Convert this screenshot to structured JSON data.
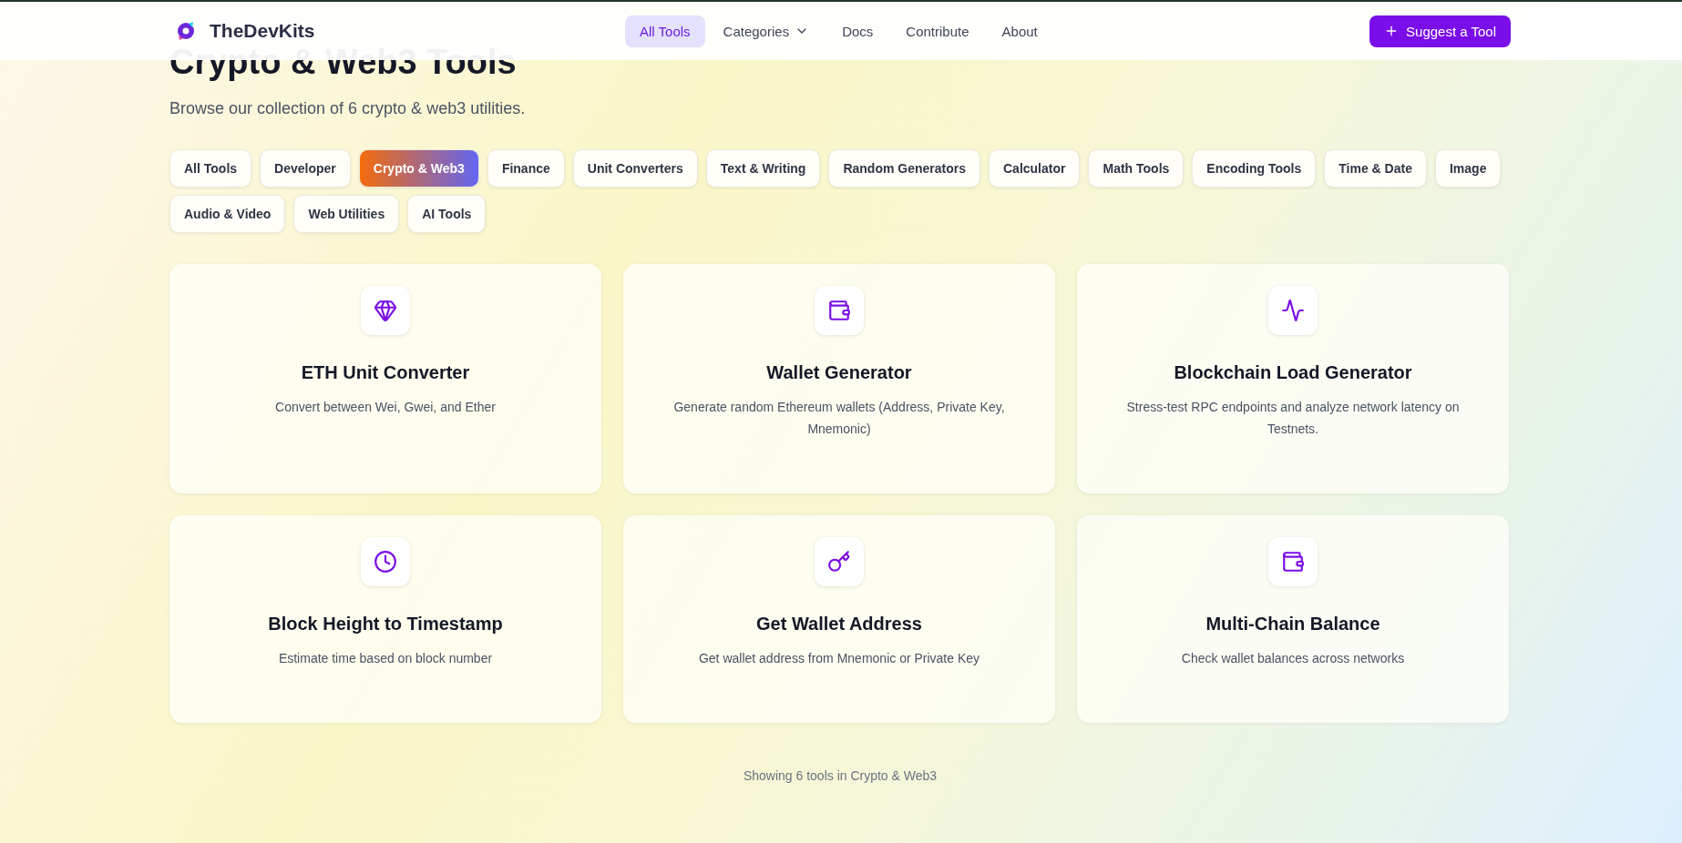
{
  "header": {
    "brand": "TheDevKits",
    "nav": [
      {
        "label": "All Tools",
        "selected": true,
        "dropdown": false
      },
      {
        "label": "Categories",
        "selected": false,
        "dropdown": true
      },
      {
        "label": "Docs",
        "selected": false,
        "dropdown": false
      },
      {
        "label": "Contribute",
        "selected": false,
        "dropdown": false
      },
      {
        "label": "About",
        "selected": false,
        "dropdown": false
      }
    ],
    "action": "Suggest a Tool"
  },
  "page": {
    "title": "Crypto & Web3 Tools",
    "subtitle": "Browse our collection of 6 crypto & web3 utilities."
  },
  "categories": [
    {
      "label": "All Tools",
      "selected": false
    },
    {
      "label": "Developer",
      "selected": false
    },
    {
      "label": "Crypto & Web3",
      "selected": true
    },
    {
      "label": "Finance",
      "selected": false
    },
    {
      "label": "Unit Converters",
      "selected": false
    },
    {
      "label": "Text & Writing",
      "selected": false
    },
    {
      "label": "Random Generators",
      "selected": false
    },
    {
      "label": "Calculator",
      "selected": false
    },
    {
      "label": "Math Tools",
      "selected": false
    },
    {
      "label": "Encoding Tools",
      "selected": false
    },
    {
      "label": "Time & Date",
      "selected": false
    },
    {
      "label": "Image",
      "selected": false
    },
    {
      "label": "Audio & Video",
      "selected": false
    },
    {
      "label": "Web Utilities",
      "selected": false
    },
    {
      "label": "AI Tools",
      "selected": false
    }
  ],
  "tools": [
    {
      "kind": "gem",
      "title": "ETH Unit Converter",
      "description": "Convert between Wei, Gwei, and Ether"
    },
    {
      "kind": "wallet",
      "title": "Wallet Generator",
      "description": "Generate random Ethereum wallets (Address, Private Key, Mnemonic)"
    },
    {
      "kind": "activity",
      "title": "Blockchain Load Generator",
      "description": "Stress-test RPC endpoints and analyze network latency on Testnets."
    },
    {
      "kind": "clock",
      "title": "Block Height to Timestamp",
      "description": "Estimate time based on block number"
    },
    {
      "kind": "key",
      "title": "Get Wallet Address",
      "description": "Get wallet address from Mnemonic or Private Key"
    },
    {
      "kind": "wallet",
      "title": "Multi-Chain Balance",
      "description": "Check wallet balances across networks"
    }
  ],
  "footer": "Showing 6 tools in Crypto & Web3"
}
